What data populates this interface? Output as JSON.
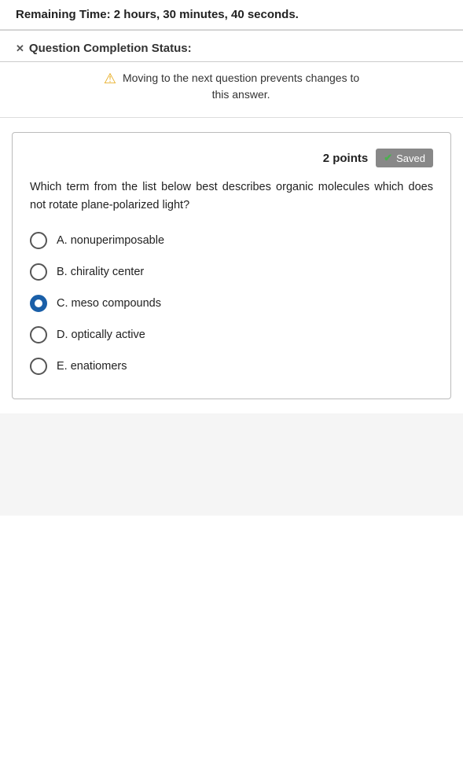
{
  "header": {
    "remaining_time_label": "Remaining Time:",
    "remaining_time_value": "2 hours, 30 minutes, 40 seconds."
  },
  "question_completion": {
    "collapse_symbol": "✕",
    "title": "Question Completion Status:"
  },
  "warning": {
    "icon": "⚠",
    "line1": "Moving to the next question prevents changes to",
    "line2": "this answer."
  },
  "question_card": {
    "points_label": "2 points",
    "saved_label": "Saved",
    "question_text": "Which term from the list below best describes organic molecules which does not rotate plane-polarized light?",
    "options": [
      {
        "id": "A",
        "label": "A.  nonuperimposable",
        "selected": false
      },
      {
        "id": "B",
        "label": "B.  chirality center",
        "selected": false
      },
      {
        "id": "C",
        "label": "C.  meso compounds",
        "selected": true
      },
      {
        "id": "D",
        "label": "D.  optically active",
        "selected": false
      },
      {
        "id": "E",
        "label": "E.  enatiomers",
        "selected": false
      }
    ]
  }
}
